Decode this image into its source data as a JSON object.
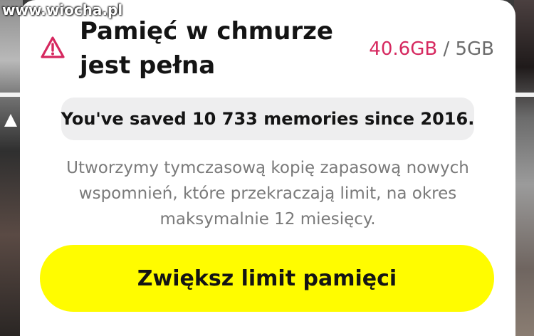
{
  "watermark": "www.wiocha.pl",
  "dialog": {
    "title": "Pamięć w chmurze jest pełna",
    "storage": {
      "used": "40.6GB",
      "separator": "/",
      "limit": "5GB"
    },
    "stats_message": "You've saved 10 733 memories since 2016.",
    "description": "Utworzymy tymczasową kopię zapasową nowych wspomnień, które przekraczają limit, na okres maksymalnie 12 miesięcy.",
    "primary_button_label": "Zwiększ limit pamięci"
  },
  "icons": {
    "warning": "warning-triangle-icon"
  },
  "colors": {
    "accent_yellow": "#fffc00",
    "used_storage_red": "#d6285f",
    "muted_text": "#7a7a7a",
    "pill_background": "#eeeeef"
  }
}
